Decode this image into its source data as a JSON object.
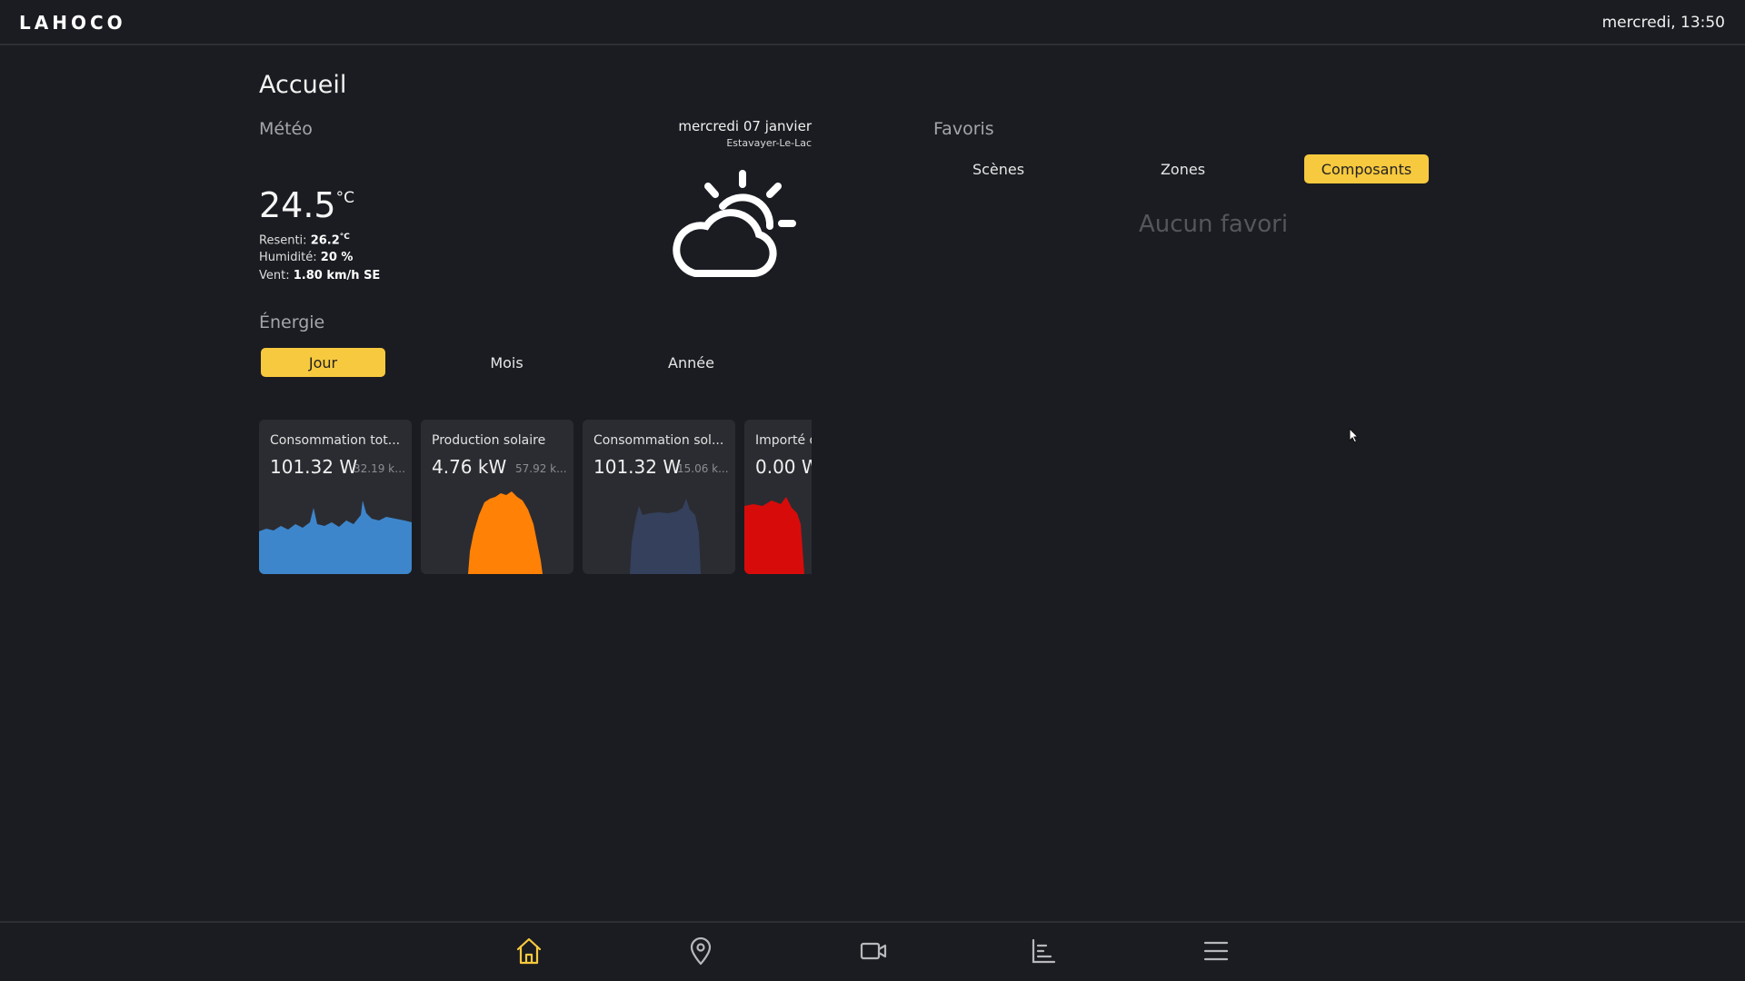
{
  "header": {
    "brand": "LAHOCO",
    "clock": "mercredi, 13:50"
  },
  "page": {
    "title": "Accueil"
  },
  "weather": {
    "label": "Météo",
    "date": "mercredi 07 janvier",
    "location": "Estavayer-Le-Lac",
    "temperature": "24.5",
    "unit": "°C",
    "feels_label": "Resenti:",
    "feels_value": "26.2",
    "feels_unit": "°C",
    "humidity_label": "Humidité:",
    "humidity_value": "20 %",
    "wind_label": "Vent:",
    "wind_value": "1.80 km/h SE",
    "icon": "partly-cloudy-icon"
  },
  "energy": {
    "label": "Énergie",
    "periods": [
      "Jour",
      "Mois",
      "Année"
    ],
    "selected_period": "Jour",
    "cards": [
      {
        "title": "Consommation tot...",
        "value": "101.32 W",
        "sub": "32.19 kW...",
        "color": "#3d86cc"
      },
      {
        "title": "Production solaire",
        "value": "4.76 kW",
        "sub": "57.92 k...",
        "color": "#ff8106"
      },
      {
        "title": "Consommation sol...",
        "value": "101.32 W",
        "sub": "15.06 k...",
        "color": "#34405c"
      },
      {
        "title": "Importé d",
        "value": "0.00 W",
        "sub": "",
        "color": "#d80b0b"
      }
    ]
  },
  "favorites": {
    "label": "Favoris",
    "tabs": [
      "Scènes",
      "Zones",
      "Composants"
    ],
    "selected_tab": "Composants",
    "empty_text": "Aucun favori"
  },
  "bottom_nav": {
    "items": [
      "home-icon",
      "location-pin-icon",
      "camera-icon",
      "list-icon",
      "menu-icon"
    ],
    "active": "home-icon",
    "active_color": "#f7c93e",
    "inactive_color": "#b8b8bc"
  }
}
